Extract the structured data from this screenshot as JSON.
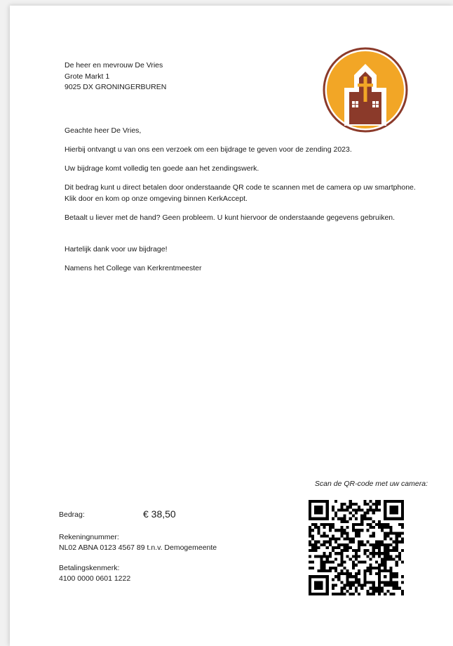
{
  "recipient": {
    "name": "De heer en mevrouw De Vries",
    "street": "Grote Markt 1",
    "city": "9025 DX GRONINGERBUREN"
  },
  "letter": {
    "greeting": "Geachte heer De Vries,",
    "paragraph1": "Hierbij ontvangt u van ons een verzoek om een bijdrage te geven voor de zending 2023.",
    "paragraph2": "Uw bijdrage komt volledig ten goede aan het zendingswerk.",
    "paragraph3": "Dit bedrag kunt u direct betalen door onderstaande QR code te scannen met de camera op uw smartphone. Klik door en kom op onze omgeving binnen KerkAccept.",
    "paragraph4": "Betaalt u liever met de hand? Geen probleem. U kunt hiervoor de onderstaande gegevens gebruiken.",
    "thanks": "Hartelijk dank voor uw bijdrage!",
    "signature": "Namens het College van Kerkrentmeester"
  },
  "payment": {
    "amount_label": "Bedrag:",
    "amount": "€ 38,50",
    "account_label": "Rekeningnummer:",
    "account": "NL02 ABNA 0123 4567 89 t.n.v. Demogemeente",
    "reference_label": "Betalingskenmerk:",
    "reference": "4100 0000 0601 1222"
  },
  "qr": {
    "caption": "Scan de QR-code met uw camera:"
  },
  "logo": {
    "icon": "church-icon",
    "colors": {
      "ring": "#8b3a2a",
      "fill": "#f2a626",
      "church": "#8b3a2a"
    }
  }
}
